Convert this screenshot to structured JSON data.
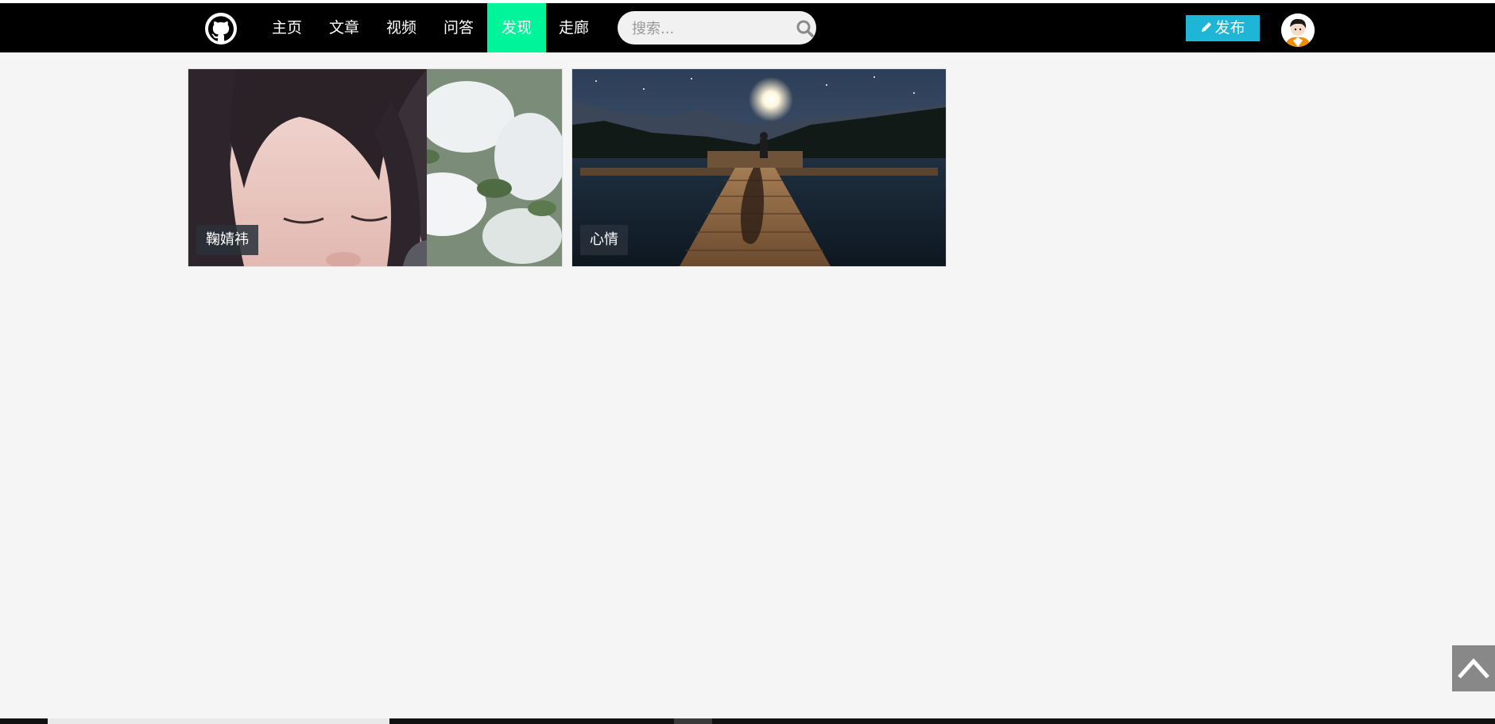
{
  "nav": {
    "logo_icon": "github-icon",
    "items": [
      {
        "label": "主页",
        "active": false
      },
      {
        "label": "文章",
        "active": false
      },
      {
        "label": "视频",
        "active": false
      },
      {
        "label": "问答",
        "active": false
      },
      {
        "label": "发现",
        "active": true
      },
      {
        "label": "走廊",
        "active": false
      }
    ],
    "active_color": "#00f59b",
    "search": {
      "placeholder": "搜索...",
      "value": "",
      "icon": "search-icon"
    },
    "publish": {
      "label": "发布",
      "icon": "pen-icon",
      "color": "#1fb5d6"
    },
    "avatar_icon": "user-avatar"
  },
  "cards": [
    {
      "tag": "鞠婧祎"
    },
    {
      "tag": "心情"
    }
  ],
  "back_to_top": {
    "icon": "chevron-up-icon"
  }
}
